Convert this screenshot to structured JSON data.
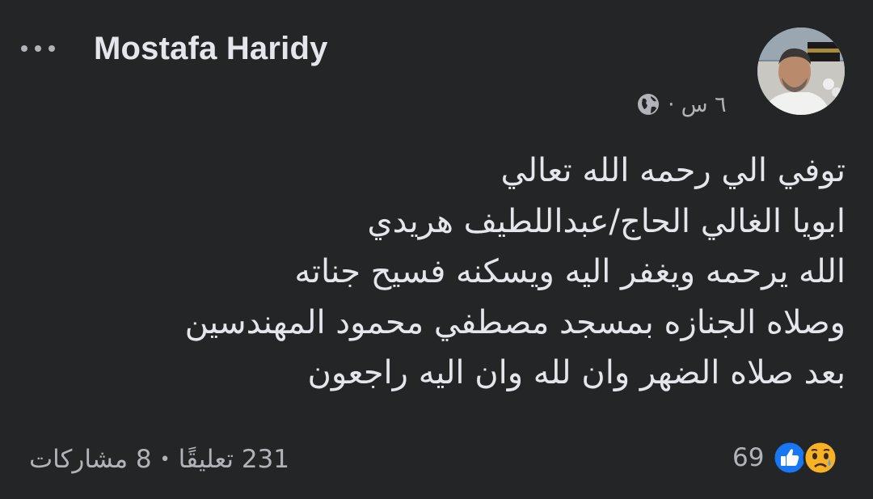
{
  "post": {
    "author_name": "Mostafa Haridy",
    "timestamp": "٦ س",
    "meta_separator": "·",
    "privacy_icon": "globe-icon",
    "body_lines": [
      "توفي الي رحمه الله تعالي",
      "ابويا الغالي الحاج/عبداللطيف هريدي",
      "الله يرحمه ويغفر اليه ويسكنه فسيح جناته",
      "وصلاه الجنازه بمسجد مصطفي محمود المهندسين",
      "بعد صلاه الضهر وان لله وان اليه راجعون"
    ]
  },
  "reactions": {
    "count": "69",
    "icons": [
      "like-icon",
      "sad-icon"
    ],
    "like_color": "#1877f2",
    "sad_color": "#f7b125"
  },
  "stats": {
    "comments": "231 تعليقًا",
    "separator": "•",
    "shares": "8 مشاركات"
  },
  "colors": {
    "background": "#242526",
    "primary_text": "#e4e6eb",
    "secondary_text": "#b0b3b8"
  }
}
